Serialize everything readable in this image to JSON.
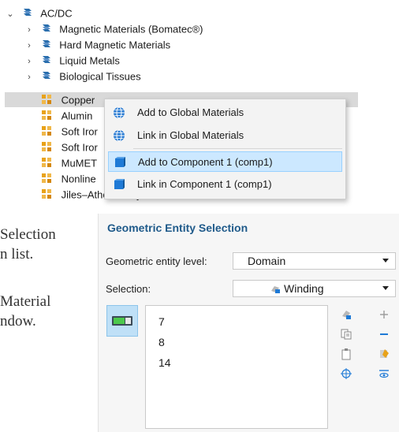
{
  "tree": {
    "root": {
      "label": "AC/DC",
      "expanded": true
    },
    "folders": [
      {
        "label": "Magnetic Materials (Bomatec®)"
      },
      {
        "label": "Hard Magnetic Materials"
      },
      {
        "label": "Liquid Metals"
      },
      {
        "label": "Biological Tissues"
      }
    ],
    "materials": [
      {
        "label": "Copper",
        "selected": true
      },
      {
        "label": "Alumin"
      },
      {
        "label": "Soft Iror"
      },
      {
        "label": "Soft Iror"
      },
      {
        "label": "MuMET"
      },
      {
        "label": "Nonline"
      },
      {
        "label": "Jiles–Atherton Hysteretic Material"
      }
    ]
  },
  "context_menu": {
    "items": [
      {
        "label": "Add to Global Materials",
        "icon": "globe-icon",
        "highlighted": false
      },
      {
        "label": "Link in Global Materials",
        "icon": "globe-icon",
        "highlighted": false
      },
      {
        "label": "Add to Component 1 (comp1)",
        "icon": "cube-icon",
        "highlighted": true
      },
      {
        "label": "Link in Component 1 (comp1)",
        "icon": "cube-icon",
        "highlighted": false
      }
    ]
  },
  "background_text": [
    "Selection",
    "n list.",
    "Material",
    "ndow."
  ],
  "panel": {
    "title": "Geometric Entity Selection",
    "entity_level_label": "Geometric entity level:",
    "entity_level_value": "Domain",
    "selection_label": "Selection:",
    "selection_value": "Winding",
    "list": [
      "7",
      "8",
      "14"
    ]
  },
  "colors": {
    "accent": "#1f5a8a",
    "selection_highlight": "#cce8ff",
    "material_icon": "#e8a21a",
    "folder_icon": "#2b6fae"
  }
}
